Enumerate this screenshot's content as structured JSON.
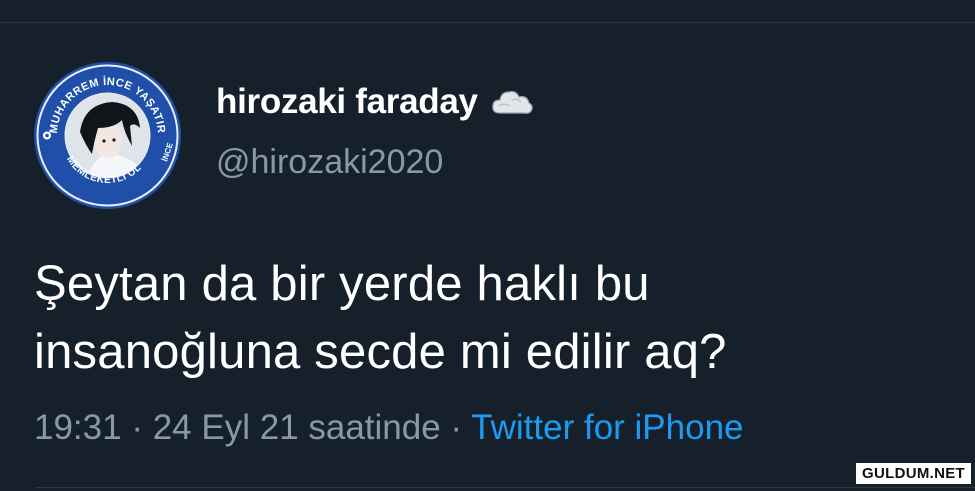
{
  "user": {
    "display_name": "hirozaki faraday",
    "handle": "@hirozaki2020",
    "name_emoji_icon": "cloud-icon",
    "avatar_text_top": "MUHARREM İNCE YAŞATIR",
    "avatar_text_bottom": "MEMLEKETLİ OL",
    "avatar_text_side": "İNCE"
  },
  "tweet": {
    "lines": [
      "Şeytan da bir yerde haklı bu",
      "insanoğluna secde mi edilir aq?"
    ],
    "time": "19:31",
    "separator": " · ",
    "date": "24 Eyl 21 saatinde",
    "source": "Twitter for iPhone"
  },
  "watermark": "GULDUM.NET",
  "colors": {
    "background": "#16202b",
    "primary_text": "#ffffff",
    "secondary_text": "#8899a6",
    "link": "#1d9bf0",
    "avatar_ring": "#1f4fa8"
  }
}
